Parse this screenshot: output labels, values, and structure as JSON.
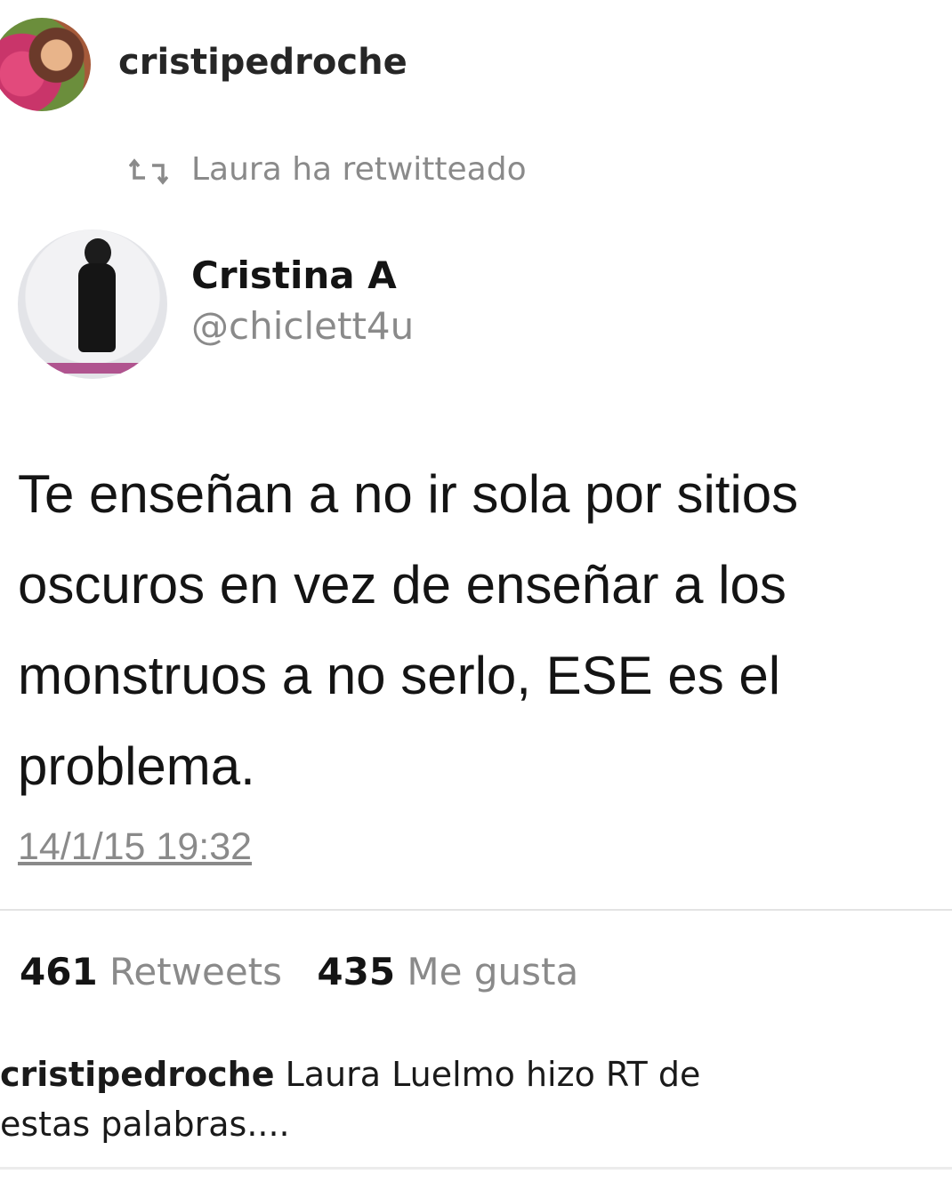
{
  "instagram_header": {
    "username": "cristipedroche"
  },
  "retweet": {
    "icon": "retweet-icon",
    "label": "Laura ha retwitteado"
  },
  "tweet": {
    "display_name": "Cristina A",
    "handle": "@chiclett4u",
    "text": "Te enseñan a no ir sola por sitios oscuros en vez de enseñar a los monstruos a no serlo, ESE es el problema.",
    "timestamp": "14/1/15 19:32",
    "retweets_count": "461",
    "retweets_label": "Retweets",
    "likes_count": "435",
    "likes_label": "Me gusta"
  },
  "caption": {
    "username": "cristipedroche",
    "text": "Laura Luelmo hizo RT de estas palabras...."
  }
}
